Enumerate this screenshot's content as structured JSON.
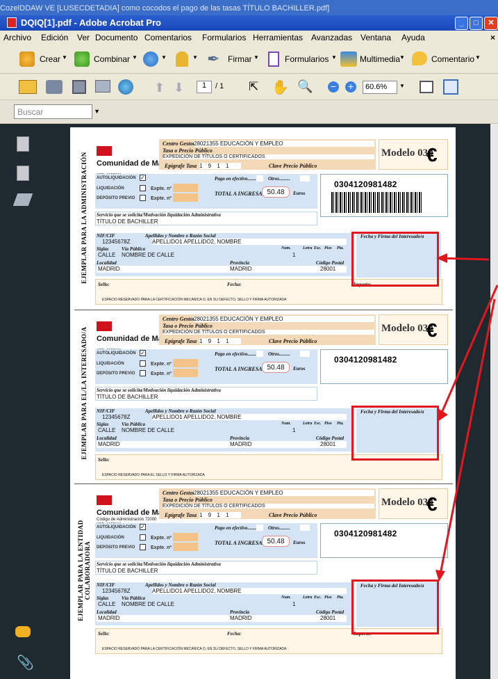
{
  "window": {
    "title": "DQIQ[1].pdf - Adobe Acrobat Pro",
    "overlay_title": "CozelDDAW VE [LUSECDETADIA] como cocodos el pago de las tasas TÍTULO BACHILLER.pdf]"
  },
  "menu": [
    "Archivo",
    "Edición",
    "Ver",
    "Documento",
    "Comentarios",
    "Formularios",
    "Herramientas",
    "Avanzadas",
    "Ventana",
    "Ayuda"
  ],
  "toolbar1": {
    "crear": "Crear",
    "combinar": "Combinar",
    "firmar": "Firmar",
    "formularios": "Formularios",
    "multimedia": "Multimedia",
    "comentario": "Comentario"
  },
  "toolbar2": {
    "page_current": "1",
    "page_total": "/ 1",
    "zoom": "60.6%"
  },
  "search": {
    "placeholder": "Buscar"
  },
  "form": {
    "centro_gestor_label": "Centro Gestor",
    "centro_gestor": "28021355 EDUCACIÓN Y EMPLEO",
    "tasa_label": "Tasa o Precio Público",
    "tasa": "EXPEDICIÓN DE TÍTULOS O CERTIFICADOS",
    "comunidad": "Comunidad de Madrid",
    "codigo_admin": "Código de Administración 72000",
    "cpr": "CPR: 9057623",
    "epigrafe_label": "Epígrafe Tasa",
    "epigrafe": "1 9 1 1",
    "clave_label": "Clave Precio Público",
    "modelo": "Modelo 030",
    "euro": "€",
    "autoliquidacion": "AUTOLIQUIDACIÓN",
    "liquidacion": "LIQUIDACIÓN",
    "deposito": "DEPÓSITO PREVIO",
    "expte": "Expte. nº",
    "pago_efectivo": "Pago en efectivo........",
    "otros": "Otros.........",
    "total_label": "TOTAL A INGRESAR",
    "total": "50.48",
    "euros": "Euros",
    "numero": "0304120981482",
    "servicio_label": "Servicio que se solicita/Motivación liquidación Administrativa",
    "servicio": "TÍTULO DE BACHILLER",
    "nif_label": "NIF/CIF",
    "nif": "12345678Z",
    "apellidos_label": "Apellidos y Nombre o Razón Social",
    "apellidos": "APELLIDO1 APELLIDO2, NOMBRE",
    "siglas_label": "Siglas",
    "siglas": "CALLE",
    "via_label": "Vía Pública",
    "via": "NOMBRE DE CALLE",
    "num_label": "Num.",
    "num": "1",
    "letra_label": "Letra",
    "esc_label": "Esc.",
    "piso_label": "Piso",
    "puerta_label": "Pta.",
    "localidad_label": "Localidad",
    "localidad": "MADRID",
    "provincia_label": "Provincia",
    "provincia": "MADRID",
    "cp_label": "Código Postal",
    "cp": "28001",
    "firma_label": "Fecha y Firma del Interesado/a",
    "sello_label": "Sello:",
    "fecha_label": "Fecha:",
    "importe_label": "Importe:",
    "reservado": "ESPACIO RESERVADO PARA LA CERTIFICACIÓN MECÁNICA O, EN SU DEFECTO, SELLO Y FIRMA AUTORIZADA",
    "reservado2": "ESPACIO RESERVADO PARA EL SELLO Y FIRMA AUTORIZADA",
    "copies": [
      "EJEMPLAR PARA LA ADMINISTRACIÓN",
      "EJEMPLAR PARA EL/LA INTERESADO/A",
      "EJEMPLAR PARA LA ENTIDAD COLABORADORA"
    ]
  },
  "colors": {
    "highlight": "#e0181e",
    "form_tan": "#f4d9b8",
    "form_blue": "#b9d2ee"
  }
}
